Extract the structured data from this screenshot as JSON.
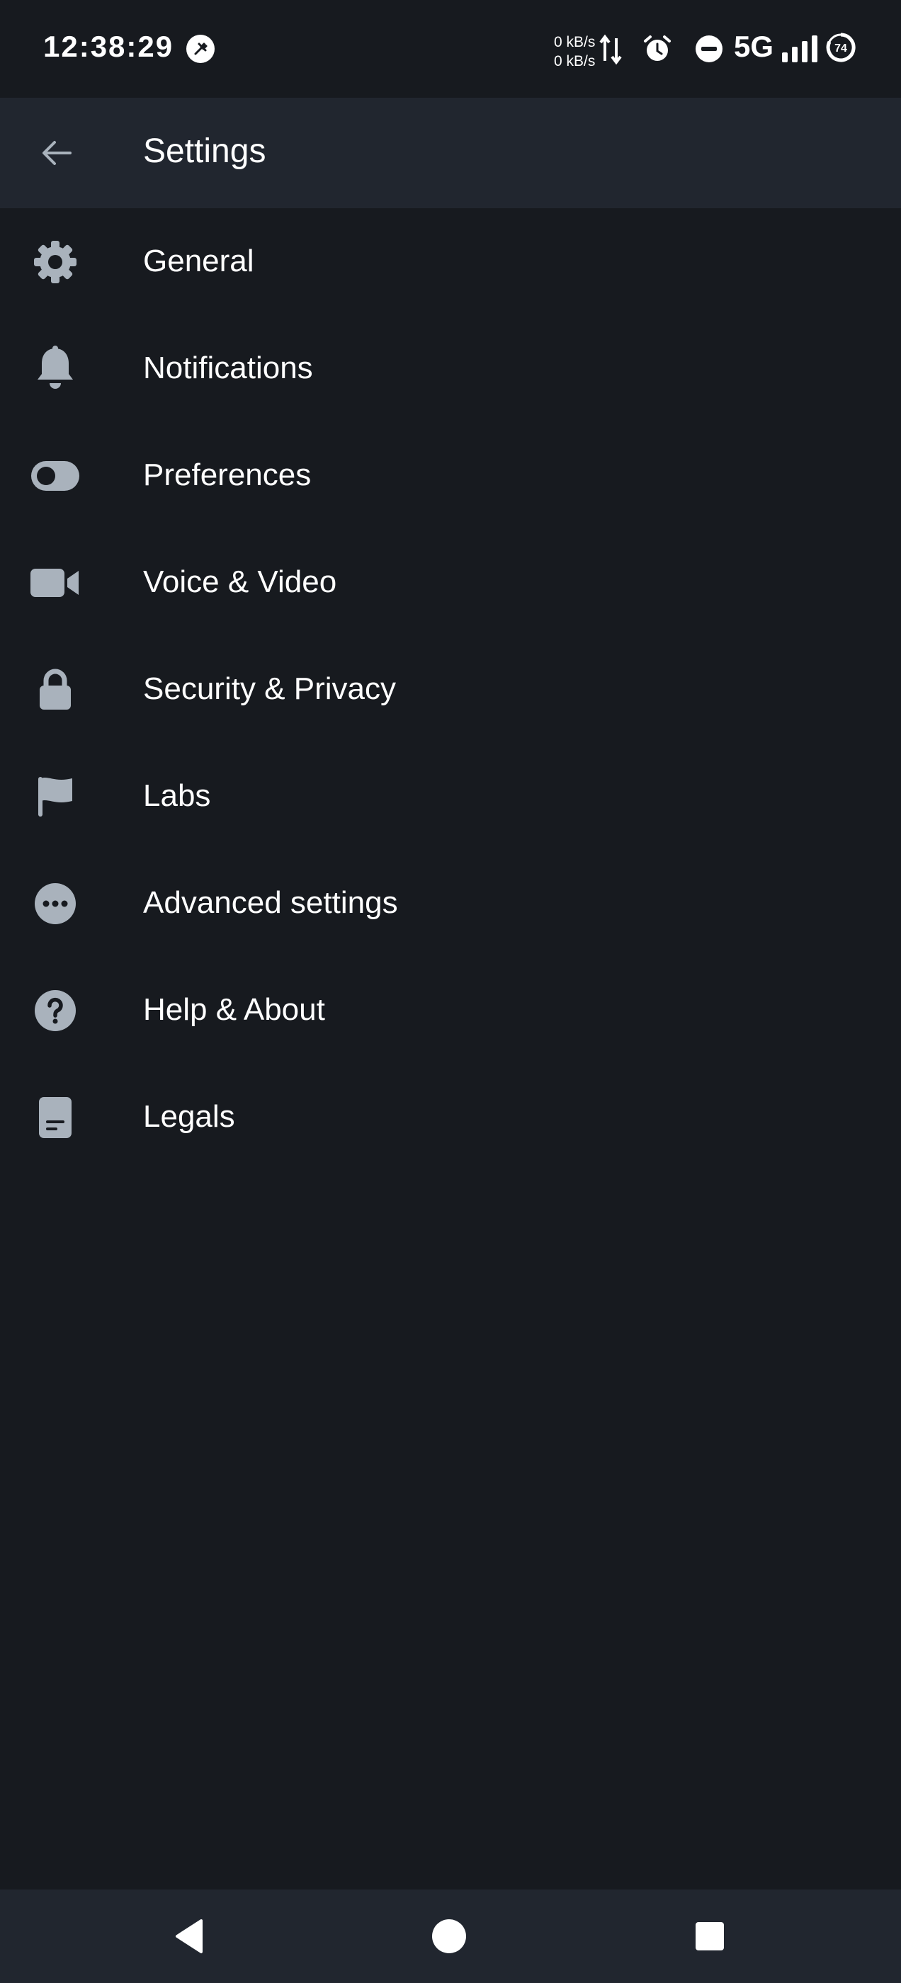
{
  "status_bar": {
    "time": "12:38:29",
    "net_speed_up": "0 kB/s",
    "net_speed_down": "0 kB/s",
    "network_type": "5G",
    "battery_level": "74",
    "icons": [
      "app-notification-icon",
      "data-transfer-icon",
      "alarm-icon",
      "do-not-disturb-icon",
      "signal-icon",
      "battery-icon"
    ]
  },
  "app_bar": {
    "back_icon": "arrow-left-icon",
    "title": "Settings"
  },
  "settings": {
    "items": [
      {
        "label": "General",
        "icon": "gear-icon"
      },
      {
        "label": "Notifications",
        "icon": "bell-icon"
      },
      {
        "label": "Preferences",
        "icon": "toggle-icon"
      },
      {
        "label": "Voice & Video",
        "icon": "video-camera-icon"
      },
      {
        "label": "Security & Privacy",
        "icon": "lock-icon"
      },
      {
        "label": "Labs",
        "icon": "flag-icon"
      },
      {
        "label": "Advanced settings",
        "icon": "more-horizontal-icon"
      },
      {
        "label": "Help & About",
        "icon": "help-circle-icon"
      },
      {
        "label": "Legals",
        "icon": "document-icon"
      }
    ]
  },
  "nav_bar": {
    "icons": [
      "back-triangle-icon",
      "home-circle-icon",
      "recents-square-icon"
    ]
  },
  "colors": {
    "background": "#171a1f",
    "app_bar": "#21262f",
    "icon": "#a9b2bc",
    "text": "#ffffff"
  }
}
